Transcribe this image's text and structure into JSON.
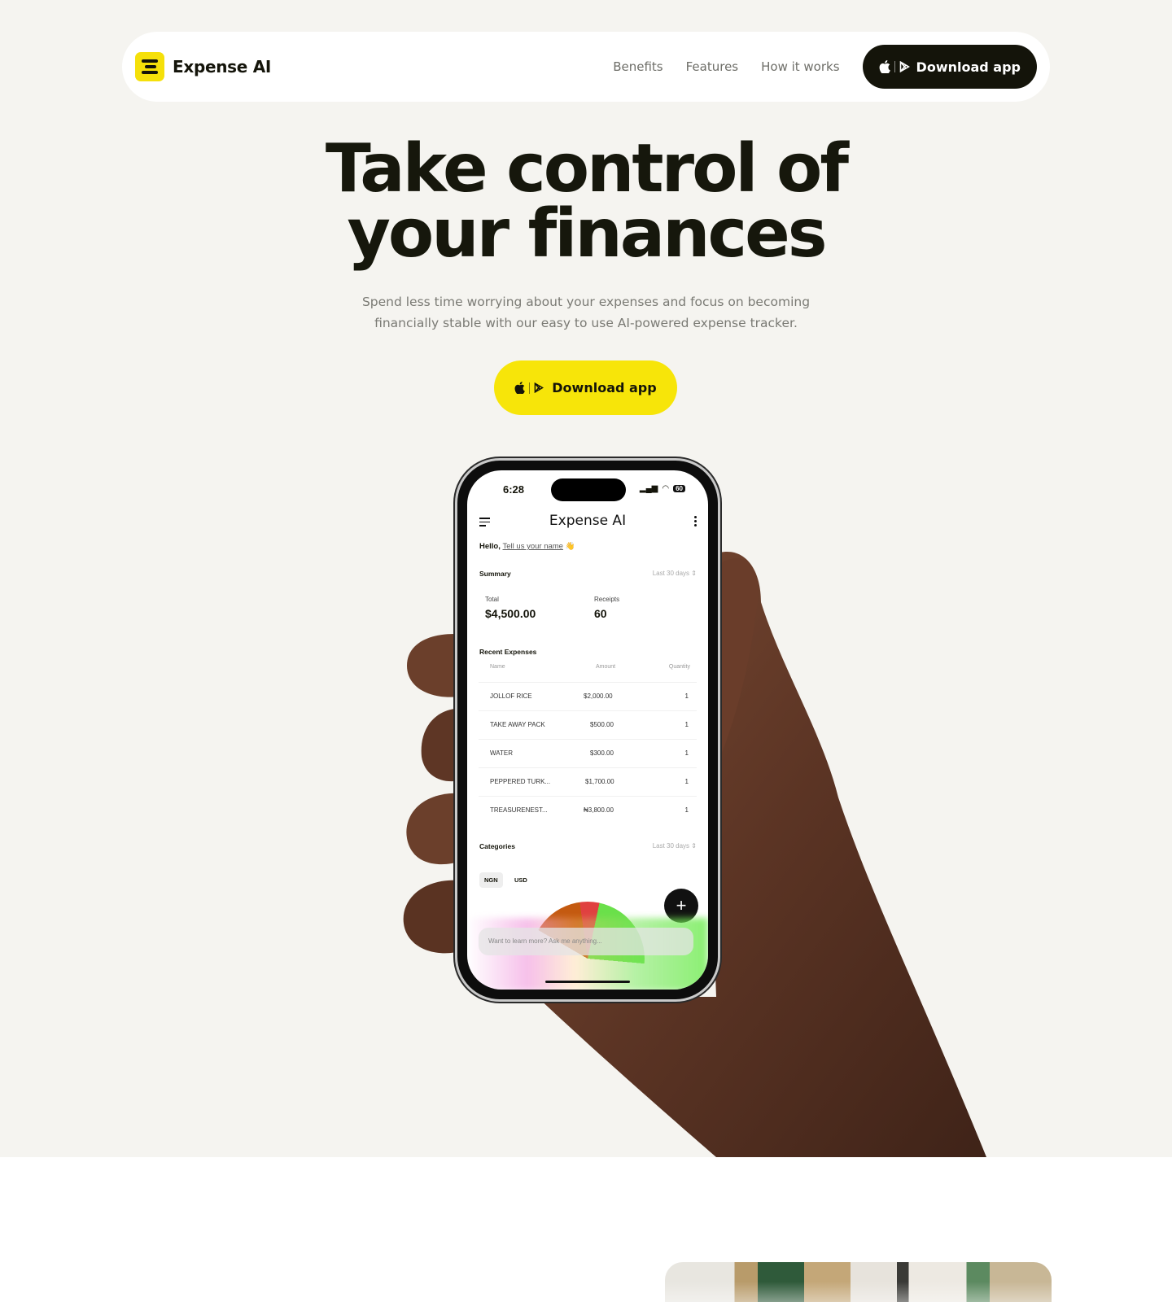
{
  "brand": {
    "name": "Expense AI",
    "accent": "#f7e509",
    "dark": "#14140a"
  },
  "nav": {
    "links": [
      "Benefits",
      "Features",
      "How it works"
    ],
    "cta": "Download app"
  },
  "hero": {
    "title_line1": "Take control of",
    "title_line2": "your finances",
    "subtitle_line1": "Spend less time worrying about your expenses and focus on becoming",
    "subtitle_line2": "financially stable with our easy to use AI-powered expense tracker.",
    "cta": "Download app"
  },
  "phone": {
    "time": "6:28",
    "battery": "60",
    "app_title": "Expense AI",
    "hello": "Hello,",
    "name_prompt": "Tell us your name",
    "summary": {
      "title": "Summary",
      "range": "Last 30 days",
      "total_label": "Total",
      "total_value": "$4,500.00",
      "receipts_label": "Receipts",
      "receipts_value": "60"
    },
    "recent": {
      "title": "Recent Expenses",
      "columns": [
        "Name",
        "Amount",
        "Quantity"
      ],
      "rows": [
        {
          "name": "JOLLOF RICE",
          "amount": "$2,000.00",
          "qty": "1"
        },
        {
          "name": "TAKE AWAY PACK",
          "amount": "$500.00",
          "qty": "1"
        },
        {
          "name": "WATER",
          "amount": "$300.00",
          "qty": "1"
        },
        {
          "name": "PEPPERED TURK...",
          "amount": "$1,700.00",
          "qty": "1"
        },
        {
          "name": "TREASURENEST...",
          "amount": "₦3,800.00",
          "qty": "1"
        }
      ]
    },
    "categories": {
      "title": "Categories",
      "range": "Last 30 days",
      "currencies": [
        "NGN",
        "USD"
      ],
      "selected": "NGN"
    },
    "fab": "+",
    "ask_placeholder": "Want to learn more? Ask me anything..."
  }
}
